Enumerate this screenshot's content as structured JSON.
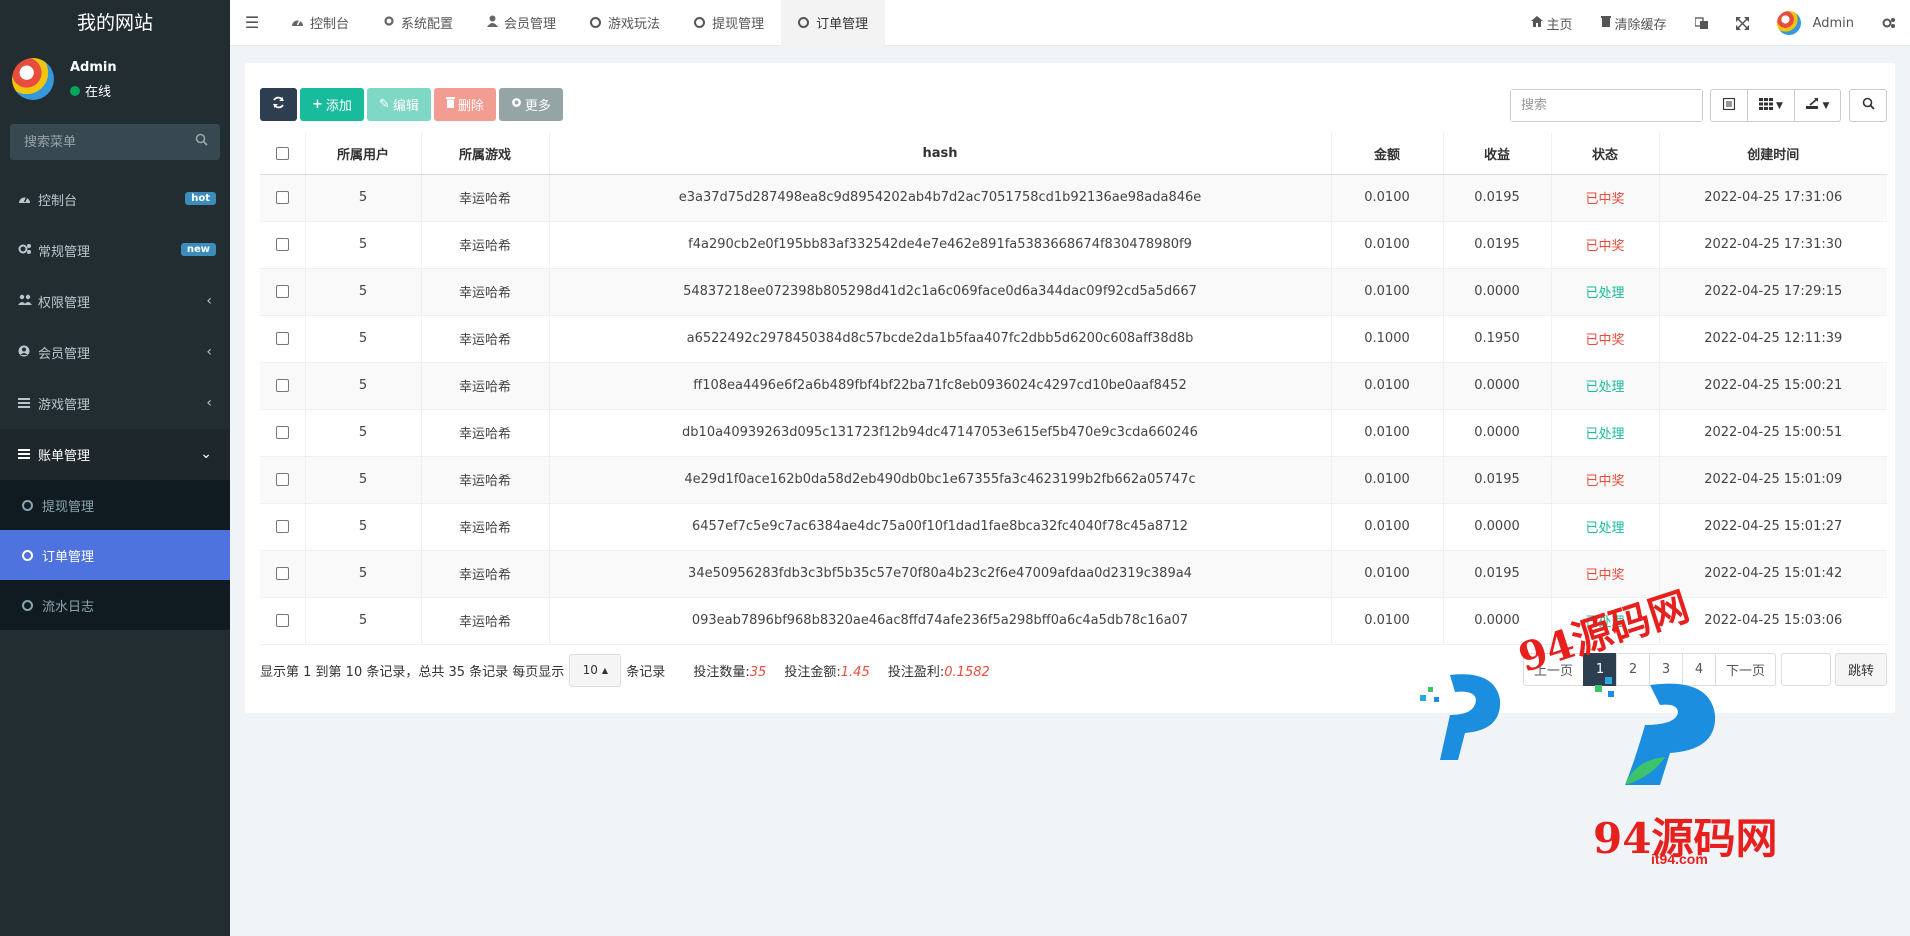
{
  "sidebar": {
    "site_title": "我的网站",
    "user_name": "Admin",
    "user_status": "在线",
    "search_placeholder": "搜索菜单",
    "menu": [
      {
        "label": "控制台",
        "icon": "dashboard-icon",
        "badge": "hot"
      },
      {
        "label": "常规管理",
        "icon": "cogs-icon",
        "badge": "new"
      },
      {
        "label": "权限管理",
        "icon": "users-icon"
      },
      {
        "label": "会员管理",
        "icon": "user-circle-icon"
      },
      {
        "label": "游戏管理",
        "icon": "list-icon"
      },
      {
        "label": "账单管理",
        "icon": "list-icon"
      }
    ],
    "submenu": [
      {
        "label": "提现管理"
      },
      {
        "label": "订单管理"
      },
      {
        "label": "流水日志"
      }
    ]
  },
  "topnav": {
    "tabs": [
      {
        "label": "控制台",
        "icon": "dashboard-icon"
      },
      {
        "label": "系统配置",
        "icon": "cogs-icon"
      },
      {
        "label": "会员管理",
        "icon": "user-icon"
      },
      {
        "label": "游戏玩法",
        "icon": "circle-icon"
      },
      {
        "label": "提现管理",
        "icon": "circle-icon"
      },
      {
        "label": "订单管理",
        "icon": "circle-icon"
      }
    ],
    "right": {
      "home": "主页",
      "clear_cache": "清除缓存",
      "admin": "Admin"
    }
  },
  "toolbar": {
    "add": "添加",
    "edit": "编辑",
    "delete": "删除",
    "more": "更多",
    "search_placeholder": "搜索"
  },
  "table": {
    "columns": [
      "所属用户",
      "所属游戏",
      "hash",
      "金额",
      "收益",
      "状态",
      "创建时间"
    ],
    "rows": [
      {
        "user": "5",
        "game": "幸运哈希",
        "hash": "e3a37d75d287498ea8c9d8954202ab4b7d2ac7051758cd1b92136ae98ada846e",
        "amount": "0.0100",
        "profit": "0.0195",
        "status": "已中奖",
        "created": "2022-04-25 17:31:06"
      },
      {
        "user": "5",
        "game": "幸运哈希",
        "hash": "f4a290cb2e0f195bb83af332542de4e7e462e891fa5383668674f830478980f9",
        "amount": "0.0100",
        "profit": "0.0195",
        "status": "已中奖",
        "created": "2022-04-25 17:31:30"
      },
      {
        "user": "5",
        "game": "幸运哈希",
        "hash": "54837218ee072398b805298d41d2c1a6c069face0d6a344dac09f92cd5a5d667",
        "amount": "0.0100",
        "profit": "0.0000",
        "status": "已处理",
        "created": "2022-04-25 17:29:15"
      },
      {
        "user": "5",
        "game": "幸运哈希",
        "hash": "a6522492c2978450384d8c57bcde2da1b5faa407fc2dbb5d6200c608aff38d8b",
        "amount": "0.1000",
        "profit": "0.1950",
        "status": "已中奖",
        "created": "2022-04-25 12:11:39"
      },
      {
        "user": "5",
        "game": "幸运哈希",
        "hash": "ff108ea4496e6f2a6b489fbf4bf22ba71fc8eb0936024c4297cd10be0aaf8452",
        "amount": "0.0100",
        "profit": "0.0000",
        "status": "已处理",
        "created": "2022-04-25 15:00:21"
      },
      {
        "user": "5",
        "game": "幸运哈希",
        "hash": "db10a40939263d095c131723f12b94dc47147053e615ef5b470e9c3cda660246",
        "amount": "0.0100",
        "profit": "0.0000",
        "status": "已处理",
        "created": "2022-04-25 15:00:51"
      },
      {
        "user": "5",
        "game": "幸运哈希",
        "hash": "4e29d1f0ace162b0da58d2eb490db0bc1e67355fa3c4623199b2fb662a05747c",
        "amount": "0.0100",
        "profit": "0.0195",
        "status": "已中奖",
        "created": "2022-04-25 15:01:09"
      },
      {
        "user": "5",
        "game": "幸运哈希",
        "hash": "6457ef7c5e9c7ac6384ae4dc75a00f10f1dad1fae8bca32fc4040f78c45a8712",
        "amount": "0.0100",
        "profit": "0.0000",
        "status": "已处理",
        "created": "2022-04-25 15:01:27"
      },
      {
        "user": "5",
        "game": "幸运哈希",
        "hash": "34e50956283fdb3c3bf5b35c57e70f80a4b23c2f6e47009afdaa0d2319c389a4",
        "amount": "0.0100",
        "profit": "0.0195",
        "status": "已中奖",
        "created": "2022-04-25 15:01:42"
      },
      {
        "user": "5",
        "game": "幸运哈希",
        "hash": "093eab7896bf968b8320ae46ac8ffd74afe236f5a298bff0a6c4a5db78c16a07",
        "amount": "0.0100",
        "profit": "0.0000",
        "status": "已处理",
        "created": "2022-04-25 15:03:06"
      }
    ]
  },
  "footer": {
    "summary": "显示第 1 到第 10 条记录，总共 35 条记录 每页显示",
    "page_size": "10",
    "records_suffix": "条记录",
    "bet_count_label": "投注数量:",
    "bet_count": "35",
    "bet_amount_label": "投注金额:",
    "bet_amount": "1.45",
    "bet_profit_label": "投注盈利:",
    "bet_profit": "0.1582",
    "pages": [
      "1",
      "2",
      "3",
      "4"
    ],
    "prev": "上一页",
    "next": "下一页",
    "jump": "跳转"
  },
  "watermark": {
    "text": "94源码网",
    "url": "it94.com"
  },
  "colors": {
    "sidebar_bg": "#222d32",
    "active_submenu": "#4e73df",
    "status_win": "#e74c3c",
    "status_done": "#18bc9c",
    "btn_add": "#18bc9c"
  }
}
